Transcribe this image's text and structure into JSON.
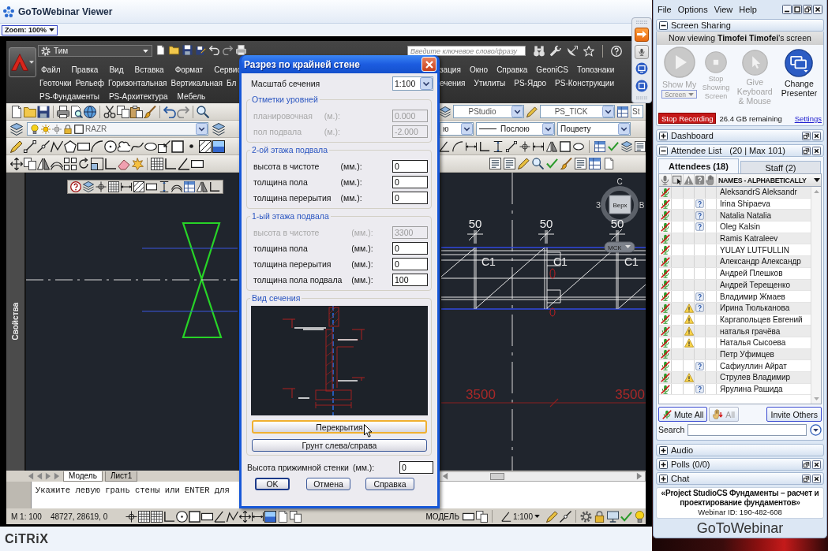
{
  "viewer": {
    "title": "GoToWebinar Viewer",
    "zoom": "Zoom: 100%",
    "vendor_logo": "CiTRiX"
  },
  "cad": {
    "workspace": "Тим",
    "search": {
      "placeholder": "Введите ключевое слово/фразу"
    },
    "menu_rows": [
      {
        "left": [
          "Файл",
          "Правка",
          "Вид",
          "Вставка",
          "Формат",
          "Сервис"
        ],
        "right": [
          "зация",
          "Окно",
          "Справка",
          "GeoniCS",
          "Топознаки"
        ]
      },
      {
        "left": [
          "Геоточки",
          "Рельеф",
          "Горизонтальная",
          "Вертикальная",
          "Бл"
        ],
        "right": [
          "ечения",
          "Утилиты",
          "PS-Ядро",
          "PS-Конструкции"
        ]
      },
      {
        "left": [
          "PS-Фундаменты",
          "PS-Архитектура",
          "Мебель"
        ]
      }
    ],
    "layer": "RAZR",
    "style_dropdowns": [
      "PStudio",
      "PS_TICK",
      "St"
    ],
    "property_dropdowns": [
      "ю",
      "Послою",
      "Поцвету"
    ],
    "palette_title": "Свойства",
    "viewcube": {
      "north": "С",
      "west": "З",
      "east": "В",
      "face": "Верх"
    },
    "ucs_menu": "МСК",
    "dimension_texts": [
      "50",
      "50",
      "50"
    ],
    "column_marks": [
      "C1",
      "C1",
      "C1"
    ],
    "span_texts": [
      "3500",
      "3500"
    ],
    "layout_tabs": [
      {
        "label": "Модель",
        "selected": true
      },
      {
        "label": "Лист1",
        "selected": false
      }
    ],
    "command_line": "Укажите левую грань стены или ENTER для",
    "status": {
      "scale": "M 1: 100",
      "coordinates": "48727, 28619, 0",
      "space": "МОДЕЛЬ",
      "annotation_scale": "1:100"
    }
  },
  "dialog": {
    "title": "Разрез по крайней стене",
    "scale_label": "Масштаб сечения",
    "scale": "1:100",
    "groups": [
      {
        "title": "Отметки уровней",
        "rows": [
          {
            "label": "планировочная",
            "unit": "(м.):",
            "value": "0.000",
            "disabled": true
          },
          {
            "label": "пол подвала",
            "unit": "(м.):",
            "value": "-2.000",
            "disabled": true
          }
        ]
      },
      {
        "title": "2-ой этажа подвала",
        "rows": [
          {
            "label": "высота в чистоте",
            "unit": "(мм.):",
            "value": "0",
            "disabled": false
          },
          {
            "label": "толщина пола",
            "unit": "(мм.):",
            "value": "0",
            "disabled": false
          },
          {
            "label": "толщина перерытия",
            "unit": "(мм.):",
            "value": "0",
            "disabled": false
          }
        ]
      },
      {
        "title": "1-ый этажа подвала",
        "rows": [
          {
            "label": "высота в чистоте",
            "unit": "(мм.):",
            "value": "3300",
            "disabled": true
          },
          {
            "label": "толщина пола",
            "unit": "(мм.):",
            "value": "0",
            "disabled": false
          },
          {
            "label": "толщина перерытия",
            "unit": "(мм.):",
            "value": "0",
            "disabled": false
          },
          {
            "label": "толщина пола подвала",
            "unit": "(мм.):",
            "value": "100",
            "disabled": false
          }
        ]
      }
    ],
    "preview": {
      "title": "Вид сечения",
      "buttons": [
        {
          "label": "Перекрытия",
          "hovered": true
        },
        {
          "label": "Грунт слева/справа",
          "hovered": false
        }
      ]
    },
    "wall_height": {
      "label": "Высота прижимной стенки",
      "unit": "(мм.):",
      "value": "0"
    },
    "buttons": [
      {
        "label": "OK",
        "focused": true
      },
      {
        "label": "Отмена",
        "focused": false
      },
      {
        "label": "Справка",
        "focused": false
      }
    ]
  },
  "panel": {
    "menu": [
      "File",
      "Options",
      "View",
      "Help"
    ],
    "screen_sharing": {
      "title": "Screen Sharing",
      "expanded": true,
      "viewing": "Now viewing **Timofei Timofei**'s screen",
      "actions": [
        {
          "kind": "play",
          "label": "Show My",
          "dropdown": "Screen",
          "disabled": true
        },
        {
          "kind": "stop",
          "label": "Stop Showing Screen",
          "disabled": true
        },
        {
          "kind": "pointer",
          "label": "Give Keyboard & Mouse",
          "disabled": true
        },
        {
          "kind": "presenter",
          "label": "Change Presenter",
          "disabled": false
        }
      ],
      "record_button": "Stop Recording",
      "storage": "26.4 GB remaining",
      "settings_link": "Settings"
    },
    "dashboard": {
      "title": "Dashboard",
      "expanded": false,
      "closable": true
    },
    "attendees": {
      "title": "Attendee List",
      "count": "(20 | Max 101)",
      "expanded": true,
      "closable": true,
      "tabs": [
        {
          "label": "Attendees (18)",
          "selected": true
        },
        {
          "label": "Staff (2)",
          "selected": false
        }
      ],
      "name_column": "NAMES - ALPHABETICALLY",
      "rows": [
        {
          "name": "AleksandrS Aleksandr",
          "muted": true,
          "warning": false,
          "question": false
        },
        {
          "name": "Irina Shipaeva",
          "muted": true,
          "warning": false,
          "question": true
        },
        {
          "name": "Natalia Natalia",
          "muted": true,
          "warning": false,
          "question": true
        },
        {
          "name": "Oleg Kalsin",
          "muted": true,
          "warning": false,
          "question": true
        },
        {
          "name": "Ramis Katraleev",
          "muted": true,
          "warning": false,
          "question": false
        },
        {
          "name": "YULAY LUTFULLIN",
          "muted": true,
          "warning": false,
          "question": false
        },
        {
          "name": "Александр Александр",
          "muted": true,
          "warning": false,
          "question": false
        },
        {
          "name": "Андрей Плешков",
          "muted": true,
          "warning": false,
          "question": false
        },
        {
          "name": "Андрей Терещенко",
          "muted": true,
          "warning": false,
          "question": false
        },
        {
          "name": "Владимир Жмаев",
          "muted": true,
          "warning": false,
          "question": true
        },
        {
          "name": "Ирина Тюльканова",
          "muted": true,
          "warning": true,
          "question": true
        },
        {
          "name": "Каргапольцев Евгений",
          "muted": true,
          "warning": true,
          "question": false
        },
        {
          "name": "наталья грачёва",
          "muted": true,
          "warning": true,
          "question": false
        },
        {
          "name": "Наталья Сысоева",
          "muted": true,
          "warning": true,
          "question": false
        },
        {
          "name": "Петр Уфимцев",
          "muted": true,
          "warning": false,
          "question": false
        },
        {
          "name": "Сафиуллин Айрат",
          "muted": true,
          "warning": false,
          "question": true
        },
        {
          "name": "Струлев Владимир",
          "muted": true,
          "warning": true,
          "question": false
        },
        {
          "name": "Ярулина Рашида",
          "muted": true,
          "warning": false,
          "question": true
        }
      ],
      "buttons": [
        {
          "kind": "mute",
          "label": "Mute All",
          "disabled": false
        },
        {
          "kind": "hand",
          "label": "All",
          "disabled": true
        },
        {
          "kind": "invite",
          "label": "Invite Others",
          "disabled": false
        }
      ],
      "search_label": "Search"
    },
    "sections": [
      {
        "title": "Audio",
        "expanded": false,
        "closable": false
      },
      {
        "title": "Polls (0/0)",
        "expanded": false,
        "closable": true
      },
      {
        "title": "Chat",
        "expanded": false,
        "closable": true
      }
    ],
    "webinar": {
      "title": "«Project StudioCS Фундаменты – расчет и проектирование фундаментов»",
      "id": "Webinar ID: 190-482-608"
    },
    "logo": "**GoTo**Webinar"
  }
}
